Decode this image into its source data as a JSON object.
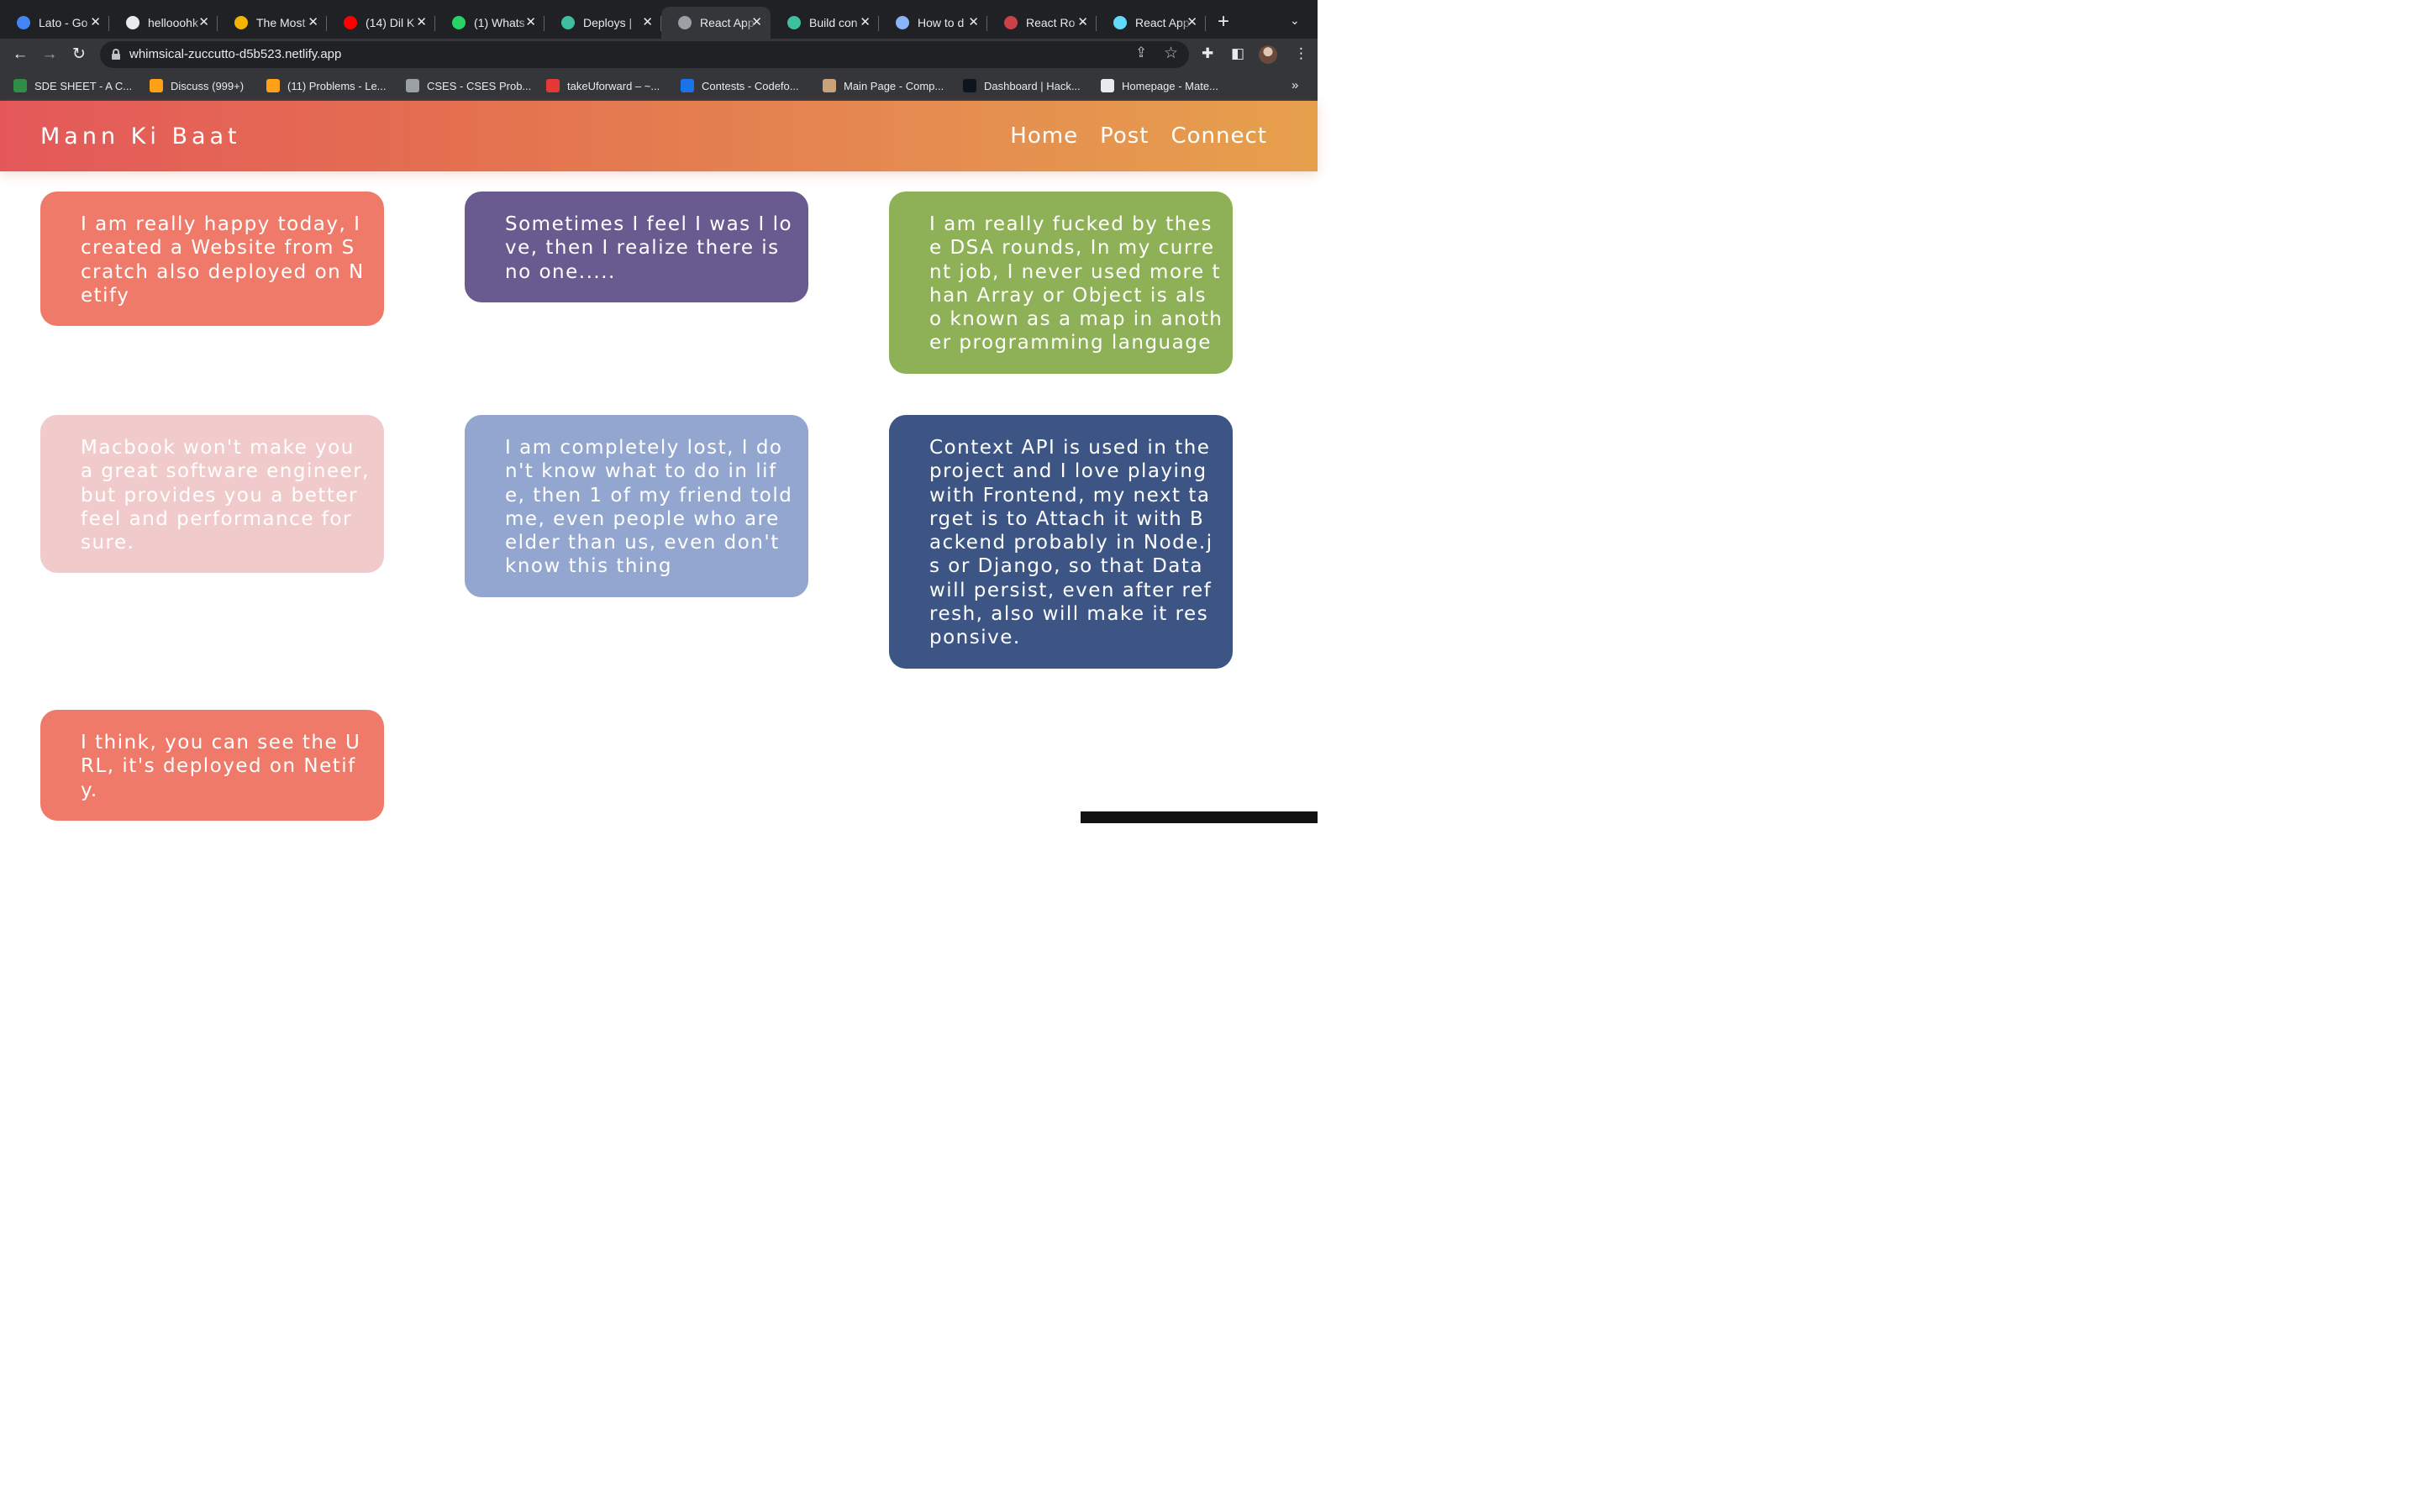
{
  "browser": {
    "tabs": [
      {
        "title": "Lato - Go",
        "fav": "google-fonts-icon",
        "color": "#4285f4"
      },
      {
        "title": "hellooohk",
        "fav": "github-icon",
        "color": "#e8eaed"
      },
      {
        "title": "The Most",
        "fav": "generic-site-icon",
        "color": "#f4b400"
      },
      {
        "title": "(14) Dil K",
        "fav": "youtube-icon",
        "color": "#ff0000"
      },
      {
        "title": "(1) Whats",
        "fav": "whatsapp-icon",
        "color": "#25d366"
      },
      {
        "title": "Deploys |",
        "fav": "netlify-icon",
        "color": "#3ebfa0"
      },
      {
        "title": "React App",
        "fav": "globe-icon",
        "color": "#9aa0a6"
      },
      {
        "title": "Build con",
        "fav": "netlify-build-icon",
        "color": "#3ebfa0"
      },
      {
        "title": "How to d",
        "fav": "a-letter-icon",
        "color": "#8ab4f8"
      },
      {
        "title": "React Ro",
        "fav": "react-router-icon",
        "color": "#ca4245"
      },
      {
        "title": "React App",
        "fav": "react-icon",
        "color": "#61dafb"
      }
    ],
    "active_tab": 6,
    "url": "whimsical-zuccutto-d5b523.netlify.app",
    "bookmarks": [
      {
        "label": "SDE SHEET - A C...",
        "color": "#2f8d46"
      },
      {
        "label": "Discuss (999+)",
        "color": "#ffa116"
      },
      {
        "label": "(11) Problems - Le...",
        "color": "#ffa116"
      },
      {
        "label": "CSES - CSES Prob...",
        "color": "#9aa0a6"
      },
      {
        "label": "takeUforward – ~...",
        "color": "#e53935"
      },
      {
        "label": "Contests - Codefo...",
        "color": "#1a73e8"
      },
      {
        "label": "Main Page - Comp...",
        "color": "#c9a27a"
      },
      {
        "label": "Dashboard | Hack...",
        "color": "#0e141e"
      },
      {
        "label": "Homepage - Mate...",
        "color": "#e8eaed"
      }
    ]
  },
  "app": {
    "brand": "Mann Ki Baat",
    "nav": [
      "Home",
      "Post",
      "Connect"
    ]
  },
  "posts": [
    {
      "lines": [
        "I am really happy today, I",
        "created a Website from S",
        "cratch also deployed on N",
        "etify"
      ],
      "bg": "#ef7a69",
      "fg": "#ffffff"
    },
    {
      "lines": [
        "Sometimes I feel I was I lo",
        "ve, then I realize there is",
        "no one....."
      ],
      "bg": "#695b8f",
      "fg": "#ffffff"
    },
    {
      "lines": [
        "I am really fucked by thes",
        "e DSA rounds, In my curre",
        "nt job, I never used more t",
        "han Array or Object is als",
        "o known as a map in anoth",
        "er programming language"
      ],
      "bg": "#8eb056",
      "fg": "#ffffff"
    },
    {
      "lines": [
        "Macbook won't make you",
        "a great software engineer,",
        "but provides you a better",
        "feel and performance for",
        "sure."
      ],
      "bg": "#f1cbcb",
      "fg": "#ffffff"
    },
    {
      "lines": [
        "I am completely lost, I do",
        "n't know what to do in lif",
        "e, then 1 of my friend told",
        "me, even people who are",
        "elder than us, even don't",
        "know this thing"
      ],
      "bg": "#93a6cf",
      "fg": "#ffffff"
    },
    {
      "lines": [
        "Context API is used in the",
        "project and I love playing",
        "with Frontend, my next ta",
        "rget is to Attach it with B",
        "ackend probably in Node.j",
        "s or Django, so that Data",
        "will persist, even after ref",
        "resh, also will make it res",
        "ponsive."
      ],
      "bg": "#3c5584",
      "fg": "#ffffff"
    },
    {
      "lines": [
        "I think, you can see the U",
        "RL, it's deployed on Netif",
        "y."
      ],
      "bg": "#ef7a69",
      "fg": "#ffffff"
    }
  ]
}
